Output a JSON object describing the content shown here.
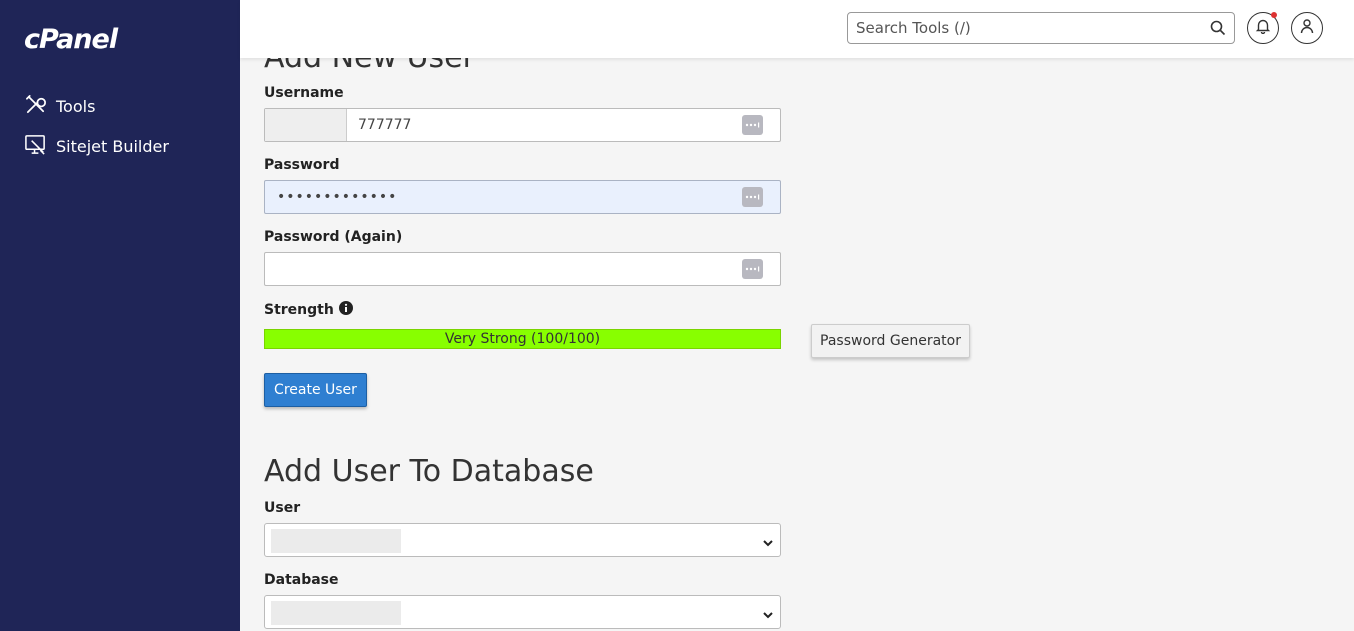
{
  "sidebar": {
    "logo": "cPanel",
    "items": [
      {
        "label": "Tools",
        "icon": "tools-icon"
      },
      {
        "label": "Sitejet Builder",
        "icon": "monitor-icon"
      }
    ]
  },
  "header": {
    "search_placeholder": "Search Tools (/)"
  },
  "main": {
    "add_user_title": "Add New User",
    "username_label": "Username",
    "username_value": "777777",
    "password_label": "Password",
    "password_value": "•••••••••••••",
    "password_again_label": "Password (Again)",
    "password_again_value": "",
    "strength_label": "Strength",
    "strength_text": "Very Strong (100/100)",
    "strength_score": 100,
    "password_generator_label": "Password Generator",
    "create_user_label": "Create User",
    "add_to_db_title": "Add User To Database",
    "user_label": "User",
    "database_label": "Database"
  },
  "colors": {
    "sidebar_bg": "#1f2557",
    "strength_bar": "#88ff00",
    "primary_button": "#2f7fd1",
    "notification_dot": "#dd3333"
  }
}
